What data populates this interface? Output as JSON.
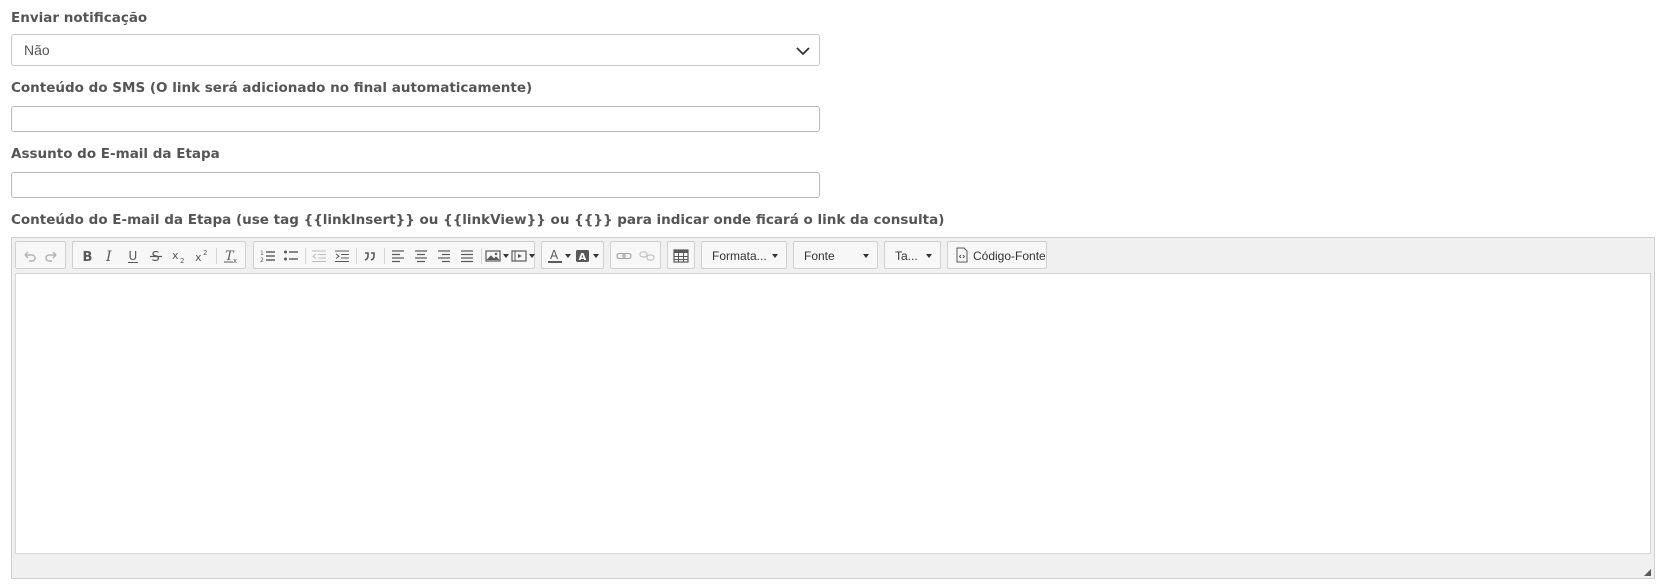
{
  "notification": {
    "label": "Enviar notificação",
    "value": "Não"
  },
  "sms": {
    "label": "Conteúdo do SMS (O link será adicionado no final automaticamente)",
    "value": ""
  },
  "subject": {
    "label": "Assunto do E-mail da Etapa",
    "value": ""
  },
  "body": {
    "label": "Conteúdo do E-mail da Etapa (use tag {{linkInsert}} ou {{linkView}} ou {{}} para indicar onde ficará o link da consulta)"
  },
  "toolbar": {
    "format_label": "Formata...",
    "font_label": "Fonte",
    "size_label": "Ta...",
    "source_label": "Código-Fonte"
  },
  "colors": {
    "label": "#555555",
    "border": "#c8c8c8",
    "toolbar_bg": "#f0f0f0"
  }
}
